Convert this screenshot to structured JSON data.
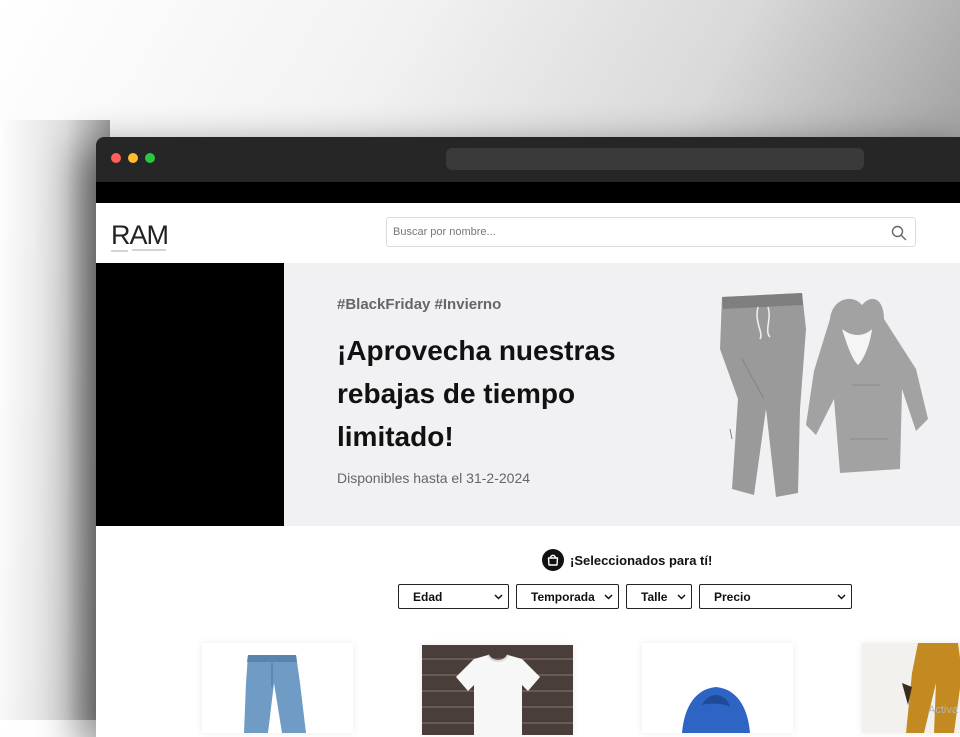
{
  "header": {
    "logo_text": "RAMÉ",
    "search": {
      "placeholder": "Buscar por nombre...",
      "value": ""
    }
  },
  "hero": {
    "hashtags": "#BlackFriday #Invierno",
    "headline": "¡Aprovecha nuestras rebajas de tiempo limitado!",
    "availability": "Disponibles hasta el 31-2-2024"
  },
  "selected": {
    "title": "¡Seleccionados para tí!"
  },
  "filters": [
    {
      "label": "Edad"
    },
    {
      "label": "Temporada"
    },
    {
      "label": "Talle"
    },
    {
      "label": "Precio"
    }
  ],
  "products": [
    {
      "icon": "jeans-image"
    },
    {
      "icon": "white-tshirt-image"
    },
    {
      "icon": "blue-hoodie-image"
    },
    {
      "icon": "mustard-pants-image"
    }
  ],
  "watermark": "Activa",
  "colors": {
    "hero_bg": "#f1f1f3",
    "hero_block": "#000000",
    "titlebar": "#262626"
  }
}
